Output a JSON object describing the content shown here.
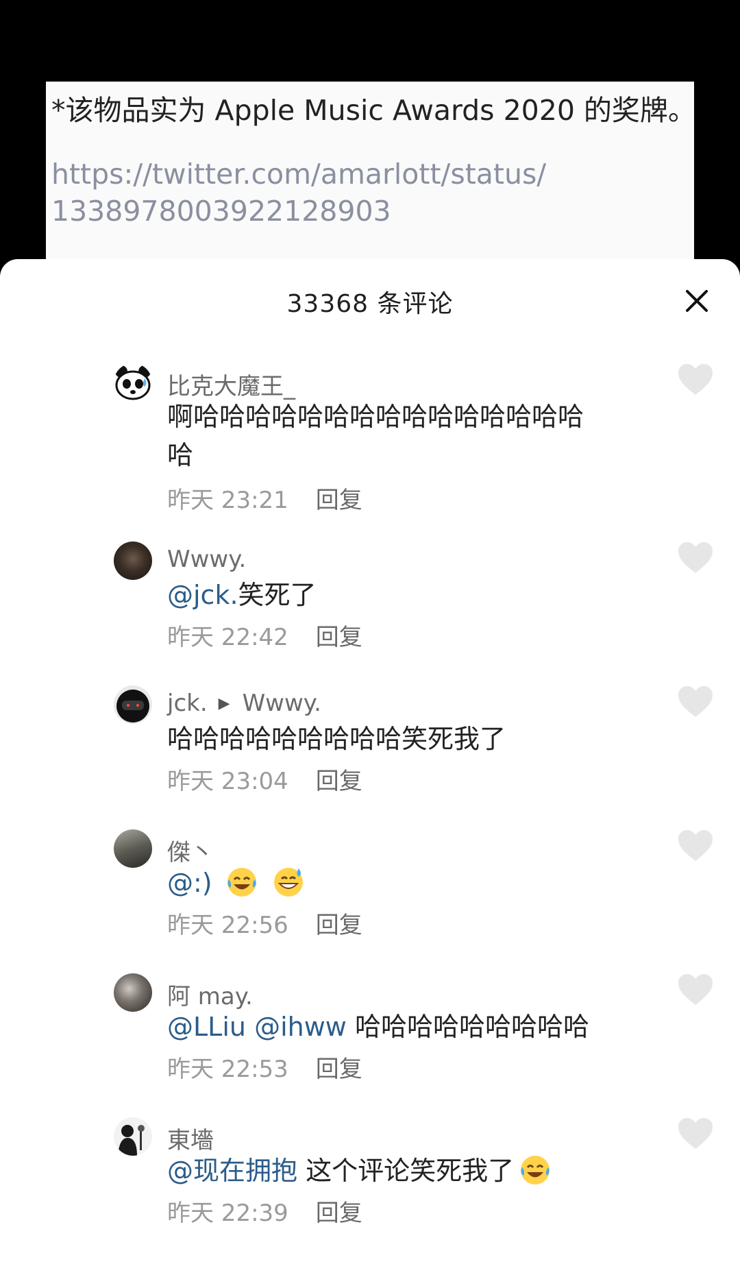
{
  "post": {
    "note": "*该物品实为 Apple Music Awards 2020 的奖牌。",
    "link_line1": "https://twitter.com/amarlott/status/",
    "link_line2": "1338978003922128903"
  },
  "sheet": {
    "title": "33368 条评论",
    "close_icon": "close-icon"
  },
  "reply_label": "回复",
  "comments": [
    {
      "name": "比克大魔王_",
      "text_line1": "啊哈哈哈哈哈哈哈哈哈哈哈哈哈哈哈",
      "text_line2": "哈",
      "time": "昨天 23:21",
      "avatar_icon": "panda-avatar"
    },
    {
      "name": "Wwwy.",
      "mention": "@jck.",
      "text": "笑死了",
      "time": "昨天 22:42",
      "avatar_icon": "dark-photo-avatar"
    },
    {
      "name": "jck.",
      "reply_to": "Wwwy.",
      "text": "哈哈哈哈哈哈哈哈哈笑死我了",
      "time": "昨天 23:04",
      "avatar_icon": "helmet-avatar"
    },
    {
      "name": "傑丶",
      "mention": "@:)",
      "emojis": [
        "laughing-tears-emoji",
        "grin-sweat-emoji"
      ],
      "time": "昨天 22:56",
      "avatar_icon": "street-photo-avatar"
    },
    {
      "name": "阿 may.",
      "mention": "@LLiu @ihww",
      "text": "哈哈哈哈哈哈哈哈哈",
      "time": "昨天 22:53",
      "avatar_icon": "portrait-avatar"
    },
    {
      "name": "東墻",
      "mention": "@现在拥抱",
      "text": "这个评论笑死我了",
      "emojis": [
        "laughing-tears-emoji"
      ],
      "time": "昨天 22:39",
      "avatar_icon": "silhouette-avatar"
    }
  ],
  "colors": {
    "mention": "#2b5c8a",
    "heart": "#e6e6e6",
    "meta": "#9a9a9a"
  }
}
